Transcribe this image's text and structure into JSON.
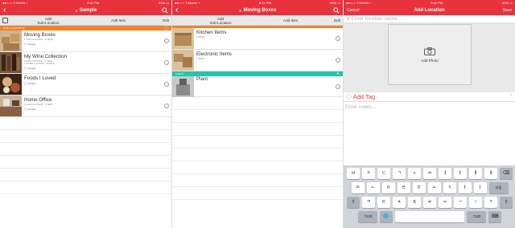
{
  "colors": {
    "accent": "#e8323c",
    "orange": "#f0822b",
    "teal": "#24c4a8"
  },
  "status": {
    "s1": {
      "carrier": "●●○○○ T-Mobile ↑",
      "time": "8:41 PM",
      "battery": "83% ▭"
    },
    "s2": {
      "carrier": "●●○○○ T-Mobile ↑",
      "time": "8:41 PM",
      "battery": "83% ▭"
    },
    "s3": {
      "carrier": "●●○○○ T-Mobile ↑",
      "time": "8:41 PM",
      "battery": "81% ▭"
    }
  },
  "screen1": {
    "title": "Sample",
    "toolbar": {
      "add_sub_line1": "Add",
      "add_sub_line2": "Sub-Location",
      "add_item": "Add Item",
      "edit": "Edit"
    },
    "section_label": "Sub-Locations",
    "rows": [
      {
        "name": "Moving Boxes",
        "sub": "2 SUB-LOCATIONS · 2 ITEMS",
        "tag": "Sample"
      },
      {
        "name": "My Wine Collection",
        "sub": "2 SUB-LOCATIONS · 2 ITEMS\n1 OTHER LOCATION · SAMPLE",
        "tag": "Sample"
      },
      {
        "name": "Foods I Loved",
        "sub": "",
        "tag": "Sample"
      },
      {
        "name": "Home Office",
        "sub": "1 SUB-LOCATIONS · 1 ITEMS",
        "tag": "Sample"
      }
    ]
  },
  "screen2": {
    "title": "Moving Boxes",
    "toolbar": {
      "add_sub_line1": "Add",
      "add_sub_line2": "Sub-Location",
      "add_item": "Add Item",
      "edit": "Edit"
    },
    "rows": [
      {
        "name": "Kitchen Items",
        "sub": "2 ITEMS"
      },
      {
        "name": "Electronic Items",
        "sub": "2 ITEMS"
      }
    ],
    "items_label": "Items",
    "item_rows": [
      {
        "name": "Plant"
      }
    ]
  },
  "screen3": {
    "title": "Add Location",
    "cancel": "Cancel",
    "save": "Save",
    "location_placeholder": "Enter location name...",
    "add_photo": "Add Photo",
    "add_tag": "Add Tag",
    "notes_placeholder": "Enter notes...",
    "keyboard": {
      "row1": [
        "ㅂ",
        "ㅈ",
        "ㄷ",
        "ㄱ",
        "ㅅ",
        "ㅛ",
        "ㅕ",
        "ㅑ",
        "ㅐ",
        "ㅔ"
      ],
      "row2": [
        "ㅁ",
        "ㄴ",
        "ㅇ",
        "ㄹ",
        "ㅎ",
        "ㅗ",
        "ㅓ",
        "ㅏ",
        "ㅣ"
      ],
      "row3": [
        "ㅋ",
        "ㅌ",
        "ㅊ",
        "ㅍ",
        "ㅠ",
        "ㅜ",
        "ㅡ"
      ],
      "punct": [
        "!",
        "?"
      ],
      "next": "다음",
      "num": ".?123"
    }
  }
}
